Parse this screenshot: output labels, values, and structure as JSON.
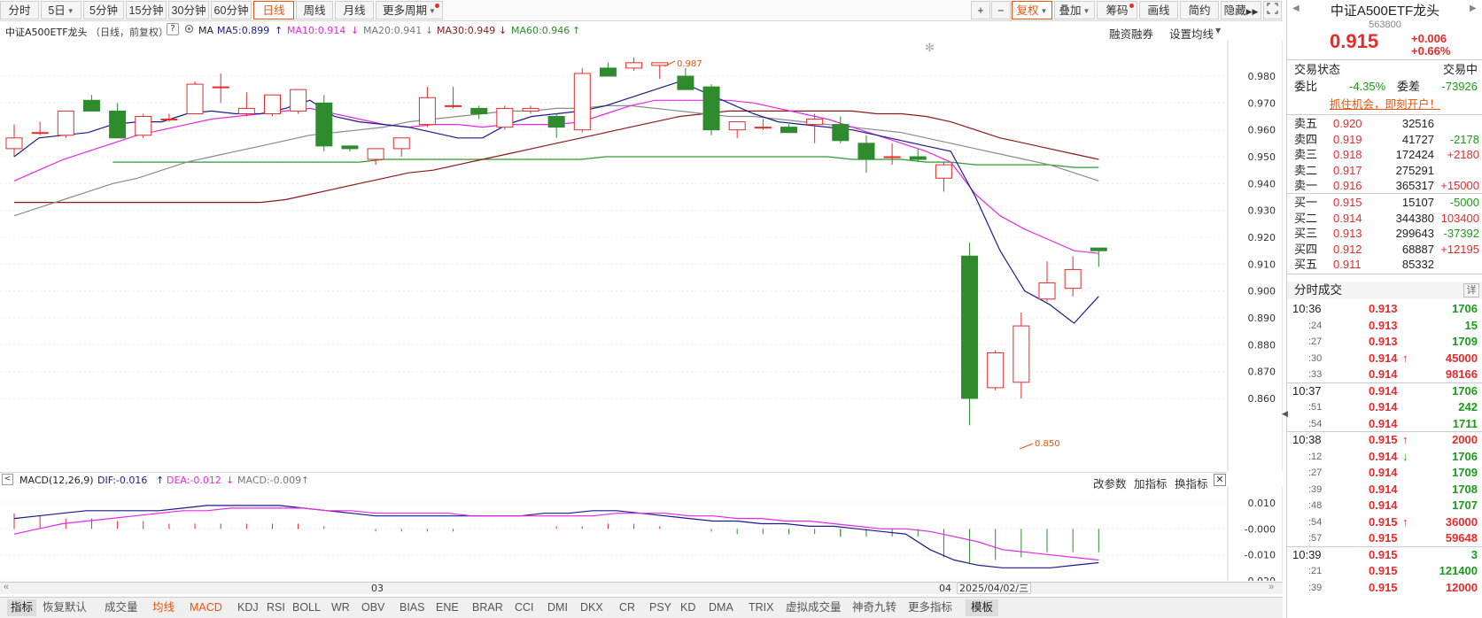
{
  "toolbar": {
    "periods": [
      "分时",
      "5日",
      "5分钟",
      "15分钟",
      "30分钟",
      "60分钟",
      "日线",
      "周线",
      "月线",
      "更多周期"
    ],
    "active_period": "日线",
    "right_tools": [
      "+",
      "−",
      "复权",
      "叠加",
      "筹码",
      "画线",
      "简约",
      "隐藏"
    ]
  },
  "info": {
    "name": "中证A500ETF龙头",
    "mode": "（日线，前复权）",
    "ma_label": "MA",
    "ma5": "MA5:0.899",
    "ma10": "MA10:0.914",
    "ma20": "MA20:0.941",
    "ma30": "MA30:0.949",
    "ma60": "MA60:0.946",
    "margin_link": "融资融券",
    "setup_ma": "设置均线"
  },
  "colors": {
    "up": "#e62b2b",
    "down": "#2e8b2e",
    "ma5": "#1a1a8c",
    "ma10": "#e628e6",
    "ma20": "#8a8a8a",
    "ma30": "#8b1a1a",
    "ma60": "#2e9b2e",
    "accent": "#e8540d"
  },
  "chart_data": {
    "type": "candlestick",
    "ylim": [
      0.851,
      0.988
    ],
    "y_ticks": [
      "0.980",
      "0.970",
      "0.960",
      "0.950",
      "0.940",
      "0.930",
      "0.920",
      "0.910",
      "0.900",
      "0.890",
      "0.880",
      "0.870",
      "0.860"
    ],
    "x_labels": [
      "03",
      "04"
    ],
    "date_label": "2025/04/02/三",
    "annotations": [
      "0.987",
      "0.850"
    ],
    "candles": [
      [
        0.953,
        0.95,
        0.962,
        0.957
      ],
      [
        0.959,
        0.958,
        0.963,
        0.959
      ],
      [
        0.958,
        0.957,
        0.967,
        0.967
      ],
      [
        0.971,
        0.97,
        0.973,
        0.967
      ],
      [
        0.967,
        0.957,
        0.97,
        0.957
      ],
      [
        0.958,
        0.957,
        0.966,
        0.965
      ],
      [
        0.964,
        0.963,
        0.966,
        0.964
      ],
      [
        0.966,
        0.966,
        0.978,
        0.977
      ],
      [
        0.976,
        0.97,
        0.981,
        0.976
      ],
      [
        0.966,
        0.965,
        0.974,
        0.968
      ],
      [
        0.966,
        0.965,
        0.972,
        0.973
      ],
      [
        0.967,
        0.966,
        0.975,
        0.975
      ],
      [
        0.97,
        0.952,
        0.973,
        0.954
      ],
      [
        0.954,
        0.952,
        0.954,
        0.953
      ],
      [
        0.949,
        0.947,
        0.952,
        0.953
      ],
      [
        0.953,
        0.95,
        0.957,
        0.957
      ],
      [
        0.962,
        0.961,
        0.976,
        0.972
      ],
      [
        0.969,
        0.968,
        0.976,
        0.969
      ],
      [
        0.968,
        0.964,
        0.969,
        0.966
      ],
      [
        0.961,
        0.96,
        0.969,
        0.968
      ],
      [
        0.967,
        0.966,
        0.969,
        0.968
      ],
      [
        0.965,
        0.957,
        0.966,
        0.961
      ],
      [
        0.96,
        0.959,
        0.983,
        0.981
      ],
      [
        0.983,
        0.98,
        0.985,
        0.98
      ],
      [
        0.983,
        0.982,
        0.987,
        0.985
      ],
      [
        0.984,
        0.979,
        0.985,
        0.985
      ],
      [
        0.98,
        0.975,
        0.983,
        0.975
      ],
      [
        0.976,
        0.958,
        0.977,
        0.96
      ],
      [
        0.96,
        0.957,
        0.963,
        0.963
      ],
      [
        0.961,
        0.96,
        0.964,
        0.961
      ],
      [
        0.961,
        0.96,
        0.962,
        0.959
      ],
      [
        0.962,
        0.955,
        0.966,
        0.964
      ],
      [
        0.962,
        0.955,
        0.965,
        0.956
      ],
      [
        0.955,
        0.944,
        0.958,
        0.949
      ],
      [
        0.95,
        0.947,
        0.955,
        0.95
      ],
      [
        0.95,
        0.948,
        0.953,
        0.949
      ],
      [
        0.942,
        0.937,
        0.948,
        0.947
      ],
      [
        0.913,
        0.85,
        0.918,
        0.86
      ],
      [
        0.864,
        0.863,
        0.878,
        0.877
      ],
      [
        0.866,
        0.86,
        0.892,
        0.887
      ],
      [
        0.897,
        0.896,
        0.911,
        0.903
      ],
      [
        0.901,
        0.898,
        0.913,
        0.908
      ],
      [
        0.916,
        0.909,
        0.916,
        0.915
      ]
    ],
    "ma5": [
      0.95,
      0.957,
      0.958,
      0.959,
      0.962,
      0.963,
      0.963,
      0.966,
      0.967,
      0.966,
      0.966,
      0.968,
      0.971,
      0.965,
      0.963,
      0.962,
      0.961,
      0.959,
      0.957,
      0.957,
      0.962,
      0.965,
      0.966,
      0.967,
      0.969,
      0.972,
      0.975,
      0.978,
      0.974,
      0.97,
      0.966,
      0.963,
      0.962,
      0.961,
      0.96,
      0.958,
      0.956,
      0.954,
      0.952,
      0.935,
      0.915,
      0.9,
      0.895,
      0.888,
      0.898
    ],
    "ma10": [
      0.941,
      0.945,
      0.949,
      0.952,
      0.955,
      0.958,
      0.96,
      0.962,
      0.964,
      0.965,
      0.966,
      0.967,
      0.968,
      0.966,
      0.964,
      0.962,
      0.961,
      0.962,
      0.962,
      0.961,
      0.962,
      0.962,
      0.962,
      0.963,
      0.966,
      0.969,
      0.971,
      0.971,
      0.971,
      0.971,
      0.97,
      0.968,
      0.966,
      0.964,
      0.961,
      0.958,
      0.955,
      0.952,
      0.948,
      0.936,
      0.928,
      0.923,
      0.919,
      0.915,
      0.914
    ],
    "ma20": [
      0.928,
      0.931,
      0.934,
      0.937,
      0.94,
      0.942,
      0.945,
      0.948,
      0.95,
      0.952,
      0.954,
      0.956,
      0.958,
      0.959,
      0.96,
      0.961,
      0.963,
      0.964,
      0.965,
      0.966,
      0.967,
      0.967,
      0.968,
      0.968,
      0.969,
      0.969,
      0.968,
      0.967,
      0.966,
      0.965,
      0.965,
      0.964,
      0.963,
      0.962,
      0.961,
      0.96,
      0.959,
      0.957,
      0.955,
      0.953,
      0.951,
      0.949,
      0.947,
      0.944,
      0.941
    ],
    "ma30": [
      0.933,
      0.933,
      0.933,
      0.933,
      0.933,
      0.933,
      0.933,
      0.933,
      0.933,
      0.933,
      0.933,
      0.934,
      0.936,
      0.938,
      0.94,
      0.942,
      0.944,
      0.945,
      0.947,
      0.949,
      0.951,
      0.953,
      0.955,
      0.957,
      0.959,
      0.961,
      0.963,
      0.965,
      0.966,
      0.967,
      0.967,
      0.967,
      0.967,
      0.967,
      0.967,
      0.966,
      0.966,
      0.965,
      0.963,
      0.96,
      0.957,
      0.955,
      0.953,
      0.951,
      0.949
    ],
    "ma60": [
      null,
      null,
      null,
      null,
      0.948,
      0.948,
      0.948,
      0.948,
      0.948,
      0.948,
      0.948,
      0.948,
      0.948,
      0.948,
      0.948,
      0.949,
      0.949,
      0.949,
      0.949,
      0.949,
      0.949,
      0.949,
      0.949,
      0.949,
      0.95,
      0.95,
      0.95,
      0.95,
      0.95,
      0.95,
      0.95,
      0.95,
      0.95,
      0.95,
      0.949,
      0.949,
      0.949,
      0.948,
      0.948,
      0.947,
      0.947,
      0.947,
      0.947,
      0.946,
      0.946
    ]
  },
  "macd": {
    "label": "MACD(12,26,9)",
    "dif": "DIF:-0.016",
    "dea": "DEA:-0.012",
    "macd": "MACD:-0.009",
    "ylim": [
      -0.022,
      0.012
    ],
    "y_ticks": [
      "0.010",
      "-0.000",
      "-0.010",
      "-0.020"
    ],
    "dif_values": [
      0.004,
      0.005,
      0.006,
      0.007,
      0.007,
      0.007,
      0.007,
      0.008,
      0.009,
      0.009,
      0.009,
      0.009,
      0.008,
      0.007,
      0.006,
      0.005,
      0.005,
      0.005,
      0.005,
      0.005,
      0.005,
      0.005,
      0.006,
      0.006,
      0.007,
      0.007,
      0.006,
      0.005,
      0.004,
      0.003,
      0.003,
      0.002,
      0.002,
      0.001,
      0.001,
      0.0,
      -0.001,
      -0.002,
      -0.008,
      -0.012,
      -0.014,
      -0.015,
      -0.015,
      -0.015,
      -0.014,
      -0.013
    ],
    "dea_values": [
      -0.002,
      0.0,
      0.002,
      0.003,
      0.004,
      0.005,
      0.006,
      0.007,
      0.007,
      0.008,
      0.008,
      0.008,
      0.008,
      0.007,
      0.007,
      0.006,
      0.006,
      0.006,
      0.006,
      0.005,
      0.005,
      0.005,
      0.005,
      0.005,
      0.005,
      0.006,
      0.006,
      0.006,
      0.005,
      0.005,
      0.004,
      0.004,
      0.003,
      0.003,
      0.002,
      0.001,
      0.0,
      0.0,
      -0.001,
      -0.003,
      -0.005,
      -0.008,
      -0.009,
      -0.01,
      -0.011,
      -0.012
    ],
    "hist_values": [
      0.006,
      0.005,
      0.004,
      0.004,
      0.003,
      0.003,
      0.002,
      0.002,
      0.002,
      0.002,
      0.002,
      0.002,
      0.001,
      0.001,
      0.0,
      -0.001,
      -0.001,
      -0.001,
      -0.001,
      0.0,
      0.0,
      0.0,
      0.001,
      0.001,
      0.002,
      0.002,
      0.001,
      0.0,
      -0.001,
      -0.002,
      -0.002,
      -0.002,
      -0.002,
      -0.003,
      -0.003,
      -0.003,
      -0.003,
      -0.003,
      -0.011,
      -0.013,
      -0.012,
      -0.011,
      -0.009,
      -0.009,
      -0.009
    ],
    "buttons": [
      "改参数",
      "加指标",
      "换指标"
    ]
  },
  "indicators": [
    "指标",
    "恢复默认",
    "成交量",
    "均线",
    "MACD",
    "KDJ",
    "RSI",
    "BOLL",
    "WR",
    "OBV",
    "BIAS",
    "ENE",
    "BRAR",
    "CCI",
    "DMI",
    "DKX",
    "CR",
    "PSY",
    "KD",
    "DMA",
    "TRIX",
    "虚拟成交量",
    "神奇九转",
    "更多指标",
    "模板"
  ],
  "quote": {
    "name": "中证A500ETF龙头",
    "code": "563800",
    "price": "0.915",
    "change": "+0.006",
    "pct": "+0.66%",
    "status_label": "交易状态",
    "status": "交易中",
    "ratio_label": "委比",
    "ratio": "-4.35%",
    "diff_label": "委差",
    "diff": "-73926",
    "promo": "抓住机会，即刻开户！",
    "asks": [
      {
        "label": "卖五",
        "price": "0.920",
        "vol": "32516",
        "chg": ""
      },
      {
        "label": "卖四",
        "price": "0.919",
        "vol": "41727",
        "chg": "-2178"
      },
      {
        "label": "卖三",
        "price": "0.918",
        "vol": "172424",
        "chg": "+2180"
      },
      {
        "label": "卖二",
        "price": "0.917",
        "vol": "275291",
        "chg": ""
      },
      {
        "label": "卖一",
        "price": "0.916",
        "vol": "365317",
        "chg": "+15000"
      }
    ],
    "bids": [
      {
        "label": "买一",
        "price": "0.915",
        "vol": "15107",
        "chg": "-5000"
      },
      {
        "label": "买二",
        "price": "0.914",
        "vol": "344380",
        "chg": "103400"
      },
      {
        "label": "买三",
        "price": "0.913",
        "vol": "299643",
        "chg": "-37392"
      },
      {
        "label": "买四",
        "price": "0.912",
        "vol": "68887",
        "chg": "+12195"
      },
      {
        "label": "买五",
        "price": "0.911",
        "vol": "85332",
        "chg": ""
      }
    ],
    "ticks_title": "分时成交",
    "ticks_detail": "详",
    "ticks": [
      {
        "t": "10:36",
        "p": "0.913",
        "v": "1706",
        "c": "red",
        "a": "",
        "vc": "grn"
      },
      {
        "t": ":24",
        "p": "0.913",
        "v": "15",
        "c": "red",
        "a": "",
        "vc": "grn"
      },
      {
        "t": ":27",
        "p": "0.913",
        "v": "1709",
        "c": "red",
        "a": "",
        "vc": "grn"
      },
      {
        "t": ":30",
        "p": "0.914",
        "v": "45000",
        "c": "red",
        "a": "up",
        "vc": "red"
      },
      {
        "t": ":33",
        "p": "0.914",
        "v": "98166",
        "c": "red",
        "a": "",
        "vc": "red"
      },
      {
        "t": "10:37",
        "p": "0.914",
        "v": "1706",
        "c": "red",
        "a": "",
        "vc": "grn"
      },
      {
        "t": ":51",
        "p": "0.914",
        "v": "242",
        "c": "red",
        "a": "",
        "vc": "grn"
      },
      {
        "t": ":54",
        "p": "0.914",
        "v": "1711",
        "c": "red",
        "a": "",
        "vc": "grn"
      },
      {
        "t": "10:38",
        "p": "0.915",
        "v": "2000",
        "c": "red",
        "a": "up",
        "vc": "red"
      },
      {
        "t": ":12",
        "p": "0.914",
        "v": "1706",
        "c": "red",
        "a": "down",
        "vc": "grn"
      },
      {
        "t": ":27",
        "p": "0.914",
        "v": "1709",
        "c": "red",
        "a": "",
        "vc": "grn"
      },
      {
        "t": ":39",
        "p": "0.914",
        "v": "1708",
        "c": "red",
        "a": "",
        "vc": "grn"
      },
      {
        "t": ":48",
        "p": "0.914",
        "v": "1707",
        "c": "red",
        "a": "",
        "vc": "grn"
      },
      {
        "t": ":54",
        "p": "0.915",
        "v": "36000",
        "c": "red",
        "a": "up",
        "vc": "red"
      },
      {
        "t": ":57",
        "p": "0.915",
        "v": "59648",
        "c": "red",
        "a": "",
        "vc": "red"
      },
      {
        "t": "10:39",
        "p": "0.915",
        "v": "3",
        "c": "red",
        "a": "",
        "vc": "grn"
      },
      {
        "t": ":21",
        "p": "0.915",
        "v": "121400",
        "c": "red",
        "a": "",
        "vc": "grn"
      },
      {
        "t": ":39",
        "p": "0.915",
        "v": "12000",
        "c": "red",
        "a": "",
        "vc": "red"
      }
    ]
  }
}
